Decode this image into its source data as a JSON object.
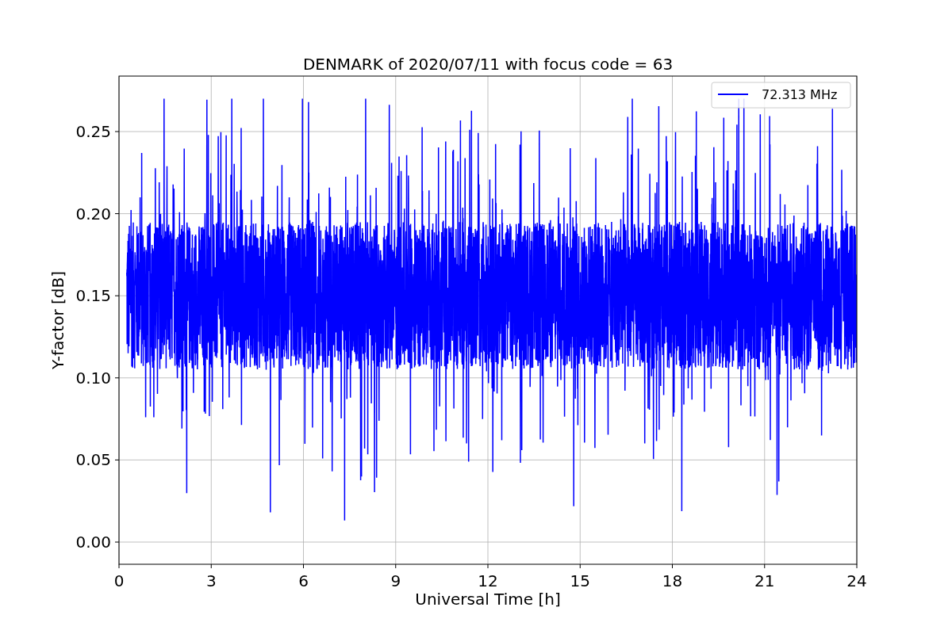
{
  "plot": {
    "title": "DENMARK of 2020/07/11 with focus code = 63",
    "xlabel": "Universal Time [h]",
    "ylabel": "Y-factor [dB]",
    "grid": true,
    "legend": [
      {
        "label": "72.313 MHz",
        "color": "#0000ff"
      }
    ],
    "x_tick_labels": [
      "0",
      "3",
      "6",
      "9",
      "12",
      "15",
      "18",
      "21",
      "24"
    ],
    "y_tick_labels": [
      "0.25",
      "0.20",
      "0.15",
      "0.10",
      "0.05",
      "0.00"
    ]
  }
}
